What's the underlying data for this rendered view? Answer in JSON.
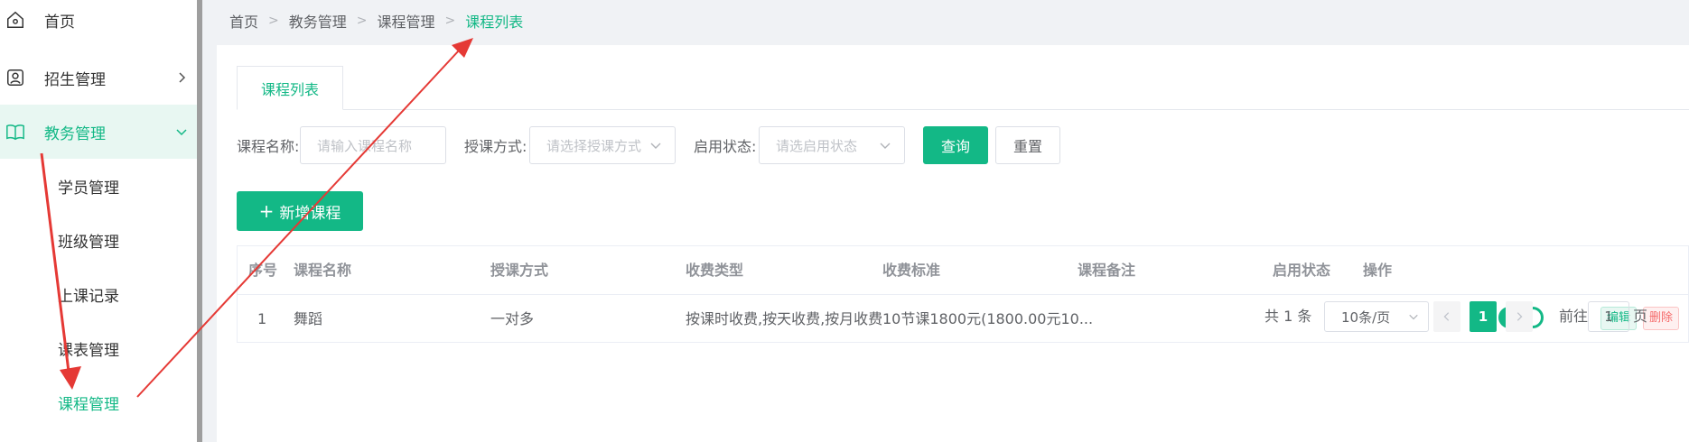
{
  "sidebar": {
    "items": [
      {
        "label": "首页",
        "icon": "home-icon"
      },
      {
        "label": "招生管理",
        "icon": "user-badge-icon"
      },
      {
        "label": "教务管理",
        "icon": "book-icon"
      }
    ],
    "submenu": [
      {
        "label": "学员管理"
      },
      {
        "label": "班级管理"
      },
      {
        "label": "上课记录"
      },
      {
        "label": "课表管理"
      },
      {
        "label": "课程管理"
      }
    ]
  },
  "breadcrumb": [
    "首页",
    "教务管理",
    "课程管理",
    "课程列表"
  ],
  "tab": {
    "label": "课程列表"
  },
  "filters": {
    "course_name_label": "课程名称:",
    "course_name_placeholder": "请输入课程名称",
    "teaching_mode_label": "授课方式:",
    "teaching_mode_placeholder": "请选择授课方式",
    "status_label": "启用状态:",
    "status_placeholder": "请选启用状态",
    "query_label": "查询",
    "reset_label": "重置"
  },
  "add_button": {
    "label": "新增课程"
  },
  "table": {
    "headers": [
      "序号",
      "课程名称",
      "授课方式",
      "收费类型",
      "收费标准",
      "课程备注",
      "启用状态",
      "操作"
    ],
    "rows": [
      {
        "index": "1",
        "name": "舞蹈",
        "mode": "一对多",
        "fee_type": "按课时收费,按天收费,按月收费",
        "fee_standard": "10节课1800元(1800.00元10...",
        "note": "",
        "enabled": true,
        "edit": "编辑",
        "delete": "删除"
      }
    ]
  },
  "pagination": {
    "total": "共 1 条",
    "page_size": "10条/页",
    "current_page": "1",
    "goto_prefix": "前往",
    "goto_value": "1",
    "goto_suffix": "页"
  },
  "colors": {
    "accent": "#13b886",
    "annotation": "#e53935"
  }
}
